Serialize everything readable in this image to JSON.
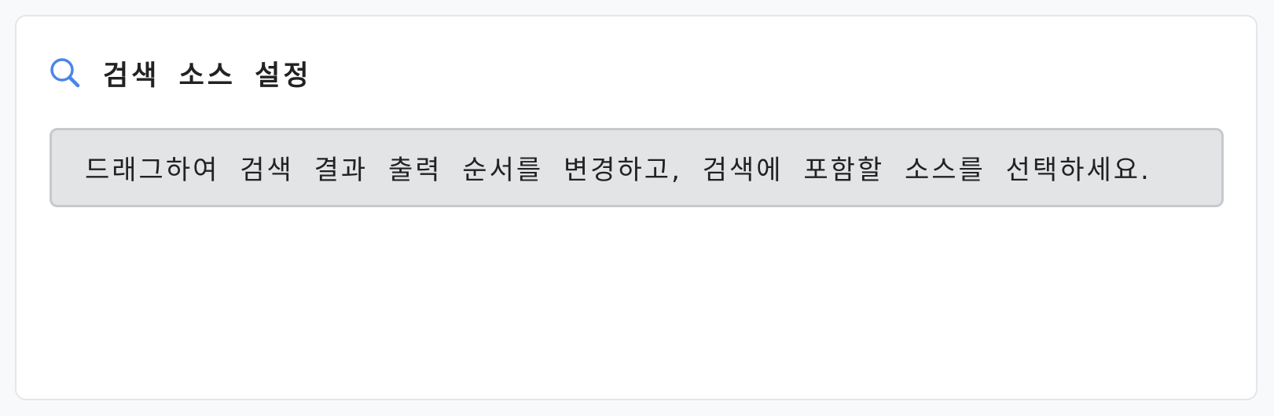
{
  "panel": {
    "title": "검색 소스 설정",
    "icon": "search-icon",
    "accent_color": "#4a86e8",
    "description": "드래그하여 검색 결과 출력 순서를 변경하고, 검색에 포함할 소스를 선택하세요."
  }
}
